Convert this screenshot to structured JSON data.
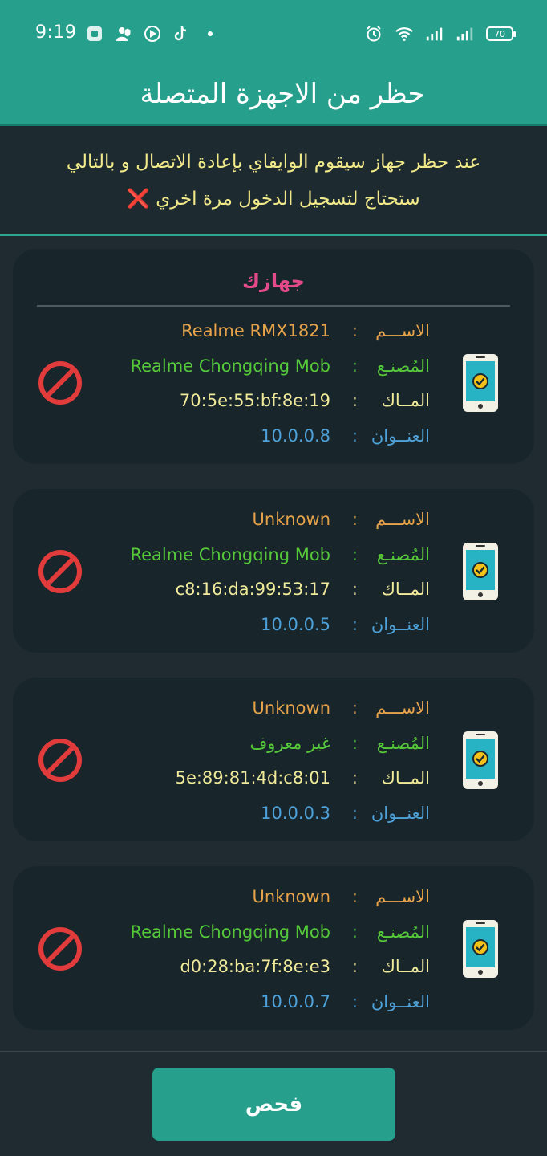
{
  "status": {
    "time": "9:19",
    "battery": "70"
  },
  "header": {
    "title": "حظر من الاجهزة المتصلة"
  },
  "warning": {
    "line1": "عند حظر جهاز سيقوم الوايفاي بإعادة الاتصال و بالتالي",
    "line2": "ستحتاج لتسجيل الدخول مرة اخري",
    "icon": "❌"
  },
  "labels": {
    "name": "الاســـم",
    "manufacturer": "المُصنـع",
    "mac": "المــاك",
    "ip": "العنــوان",
    "colon": ":"
  },
  "own_device_title": "جهازك",
  "devices": [
    {
      "name": "Realme RMX1821",
      "manufacturer": "Realme Chongqing Mob",
      "mac": "70:5e:55:bf:8e:19",
      "ip": "10.0.0.8"
    },
    {
      "name": "Unknown",
      "manufacturer": "Realme Chongqing Mob",
      "mac": "c8:16:da:99:53:17",
      "ip": "10.0.0.5"
    },
    {
      "name": "Unknown",
      "manufacturer": "غير معروف",
      "mac": "5e:89:81:4d:c8:01",
      "ip": "10.0.0.3"
    },
    {
      "name": "Unknown",
      "manufacturer": "Realme Chongqing Mob",
      "mac": "d0:28:ba:7f:8e:e3",
      "ip": "10.0.0.7"
    }
  ],
  "scan_button": "فحص",
  "colors": {
    "accent": "#26a08c",
    "name": "#e6a34a",
    "manufacturer": "#56c93a",
    "mac": "#f0ea9a",
    "ip": "#4ea2d9",
    "own_title": "#e24a8a",
    "block": "#e23b3b"
  },
  "icons": {
    "device": "phone-check-icon",
    "block": "block-icon"
  }
}
